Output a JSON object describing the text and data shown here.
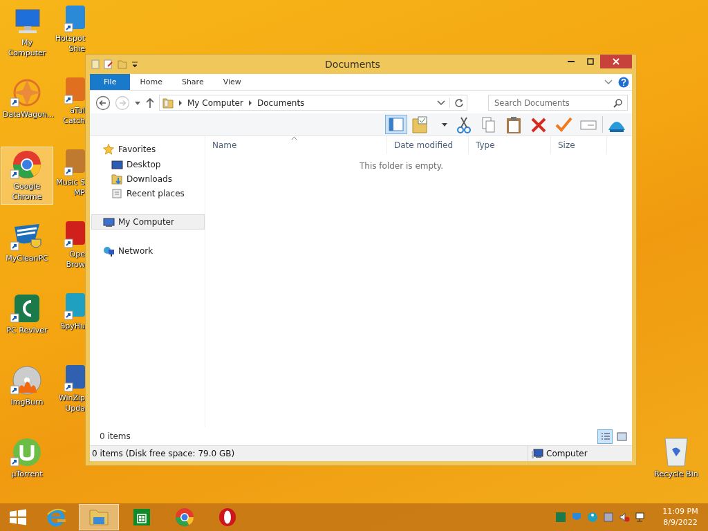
{
  "desktop_icons": [
    {
      "label": "My Computer",
      "selected": false
    },
    {
      "label": "DataWagon...",
      "selected": false
    },
    {
      "label": "Google Chrome",
      "selected": true
    },
    {
      "label": "MyCleanPC",
      "selected": false
    },
    {
      "label": "PC Reviver",
      "selected": false
    },
    {
      "label": "ImgBurn",
      "selected": false
    },
    {
      "label": "µTorrent",
      "selected": false
    }
  ],
  "partly_hidden_icons": [
    {
      "lines": [
        "Hotspot",
        "Shie"
      ]
    },
    {
      "lines": [
        "aTul",
        "Catch"
      ]
    },
    {
      "lines": [
        "Music S",
        "MP"
      ]
    },
    {
      "lines": [
        "Ope",
        "Brow"
      ]
    },
    {
      "lines": [
        "SpyHu"
      ]
    },
    {
      "lines": [
        "WinZip",
        "Upda"
      ]
    }
  ],
  "recycle_bin": {
    "label": "Recycle Bin"
  },
  "window": {
    "title": "Documents",
    "ribbon_tabs": [
      {
        "label": "File",
        "kind": "file"
      },
      {
        "label": "Home",
        "kind": "tab"
      },
      {
        "label": "Share",
        "kind": "tab"
      },
      {
        "label": "View",
        "kind": "tab"
      }
    ],
    "breadcrumb": [
      "My Computer",
      "Documents"
    ],
    "search": {
      "placeholder": "Search Documents"
    },
    "navigation": [
      {
        "label": "Favorites",
        "selected": false,
        "children": [
          {
            "label": "Desktop",
            "selected": false
          },
          {
            "label": "Downloads",
            "selected": false
          },
          {
            "label": "Recent places",
            "selected": false
          }
        ]
      },
      {
        "label": "My Computer",
        "selected": true
      },
      {
        "label": "Network",
        "selected": false
      }
    ],
    "columns": [
      "Name",
      "Date modified",
      "Type",
      "Size"
    ],
    "empty_message": "This folder is empty.",
    "item_count": "0 items",
    "view_buttons": [
      {
        "kind": "details",
        "selected": true
      },
      {
        "kind": "large",
        "selected": false
      }
    ],
    "status_bar": {
      "info": "0 items (Disk free space: 79.0 GB)",
      "location": "Computer"
    }
  },
  "taskbar": {
    "apps": [
      {
        "selected": false
      },
      {
        "selected": false
      },
      {
        "selected": true
      },
      {
        "selected": false
      },
      {
        "selected": false
      },
      {
        "selected": false
      }
    ],
    "time": "11:09 PM",
    "date": "8/9/2022"
  }
}
